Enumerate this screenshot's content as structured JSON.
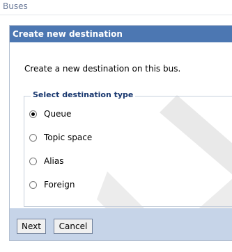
{
  "breadcrumb": "Buses",
  "panel": {
    "title": "Create new destination",
    "instruction": "Create a new destination on this bus."
  },
  "destination_type": {
    "legend": "Select destination type",
    "options": [
      {
        "label": "Queue",
        "selected": true
      },
      {
        "label": "Topic space",
        "selected": false
      },
      {
        "label": "Alias",
        "selected": false
      },
      {
        "label": "Foreign",
        "selected": false
      }
    ]
  },
  "buttons": {
    "next": "Next",
    "cancel": "Cancel"
  }
}
